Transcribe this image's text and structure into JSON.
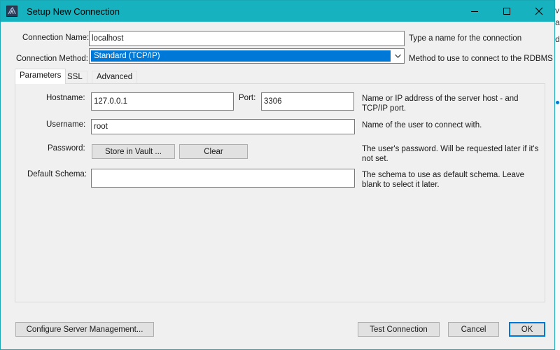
{
  "window": {
    "title": "Setup New Connection",
    "accent_color": "#17b2bf"
  },
  "connection_name": {
    "label": "Connection Name:",
    "value": "localhost",
    "hint": "Type a name for the connection"
  },
  "connection_method": {
    "label": "Connection Method:",
    "selected": "Standard (TCP/IP)",
    "hint": "Method to use to connect to the RDBMS"
  },
  "tabs": [
    {
      "label": "Parameters",
      "active": true
    },
    {
      "label": "SSL",
      "active": false
    },
    {
      "label": "Advanced",
      "active": false
    }
  ],
  "parameters": {
    "hostname": {
      "label": "Hostname:",
      "value": "127.0.0.1"
    },
    "port": {
      "label": "Port:",
      "value": "3306"
    },
    "hostname_hint": [
      "Name or IP address of the server host - and",
      "TCP/IP port."
    ],
    "username": {
      "label": "Username:",
      "value": "root",
      "hint": "Name of the user to connect with."
    },
    "password": {
      "label": "Password:",
      "store_button": "Store in Vault ...",
      "clear_button": "Clear",
      "hint": [
        "The user's password. Will be requested later if it's",
        "not set."
      ]
    },
    "default_schema": {
      "label": "Default Schema:",
      "value": "",
      "hint": [
        "The schema to use as default schema. Leave",
        "blank to select it later."
      ]
    }
  },
  "footer": {
    "configure_button": "Configure Server Management...",
    "test_button": "Test Connection",
    "cancel_button": "Cancel",
    "ok_button": "OK"
  },
  "background": {
    "text_fragments": [
      "v:",
      "a",
      "d"
    ]
  }
}
